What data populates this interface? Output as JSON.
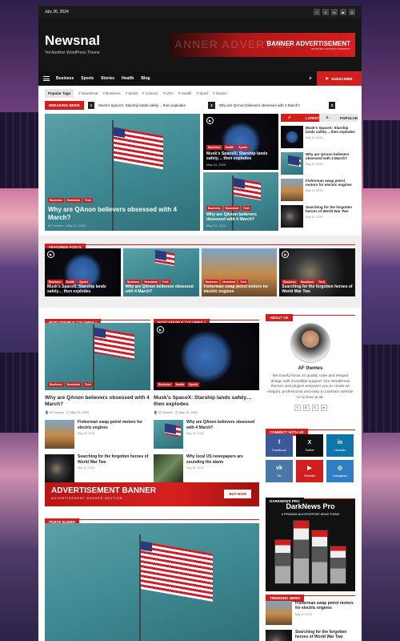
{
  "topbar": {
    "date": "July 26, 2024",
    "social": [
      "f",
      "X",
      "in",
      "▶",
      "◎"
    ]
  },
  "header": {
    "logo": "Newsnal",
    "tagline": "Yet Another WordPress Theme",
    "banner_title": "BANNER ADVERTISEMENT",
    "banner_sub": "BANNER ADVERTISEMENT",
    "banner_ghost": "ANNER ADVERTISE"
  },
  "nav": {
    "items": [
      "Business",
      "Sports",
      "Stories",
      "Health",
      "Blog"
    ],
    "subscribe": "SUBSCRIBE"
  },
  "tags": {
    "label": "Popular Tags",
    "items": [
      "# NewsDeal",
      "# Business",
      "# World",
      "# Science",
      "# USA",
      "# Health",
      "# Sport",
      "# Stories"
    ]
  },
  "breaking": {
    "label": "BREAKING NEWS",
    "items": [
      {
        "num": "1",
        "text": "Musk's SpaceX: Starship lands safely… then explodes"
      },
      {
        "num": "2",
        "text": "Why are QAnon believers obsessed with 4 March?"
      },
      {
        "num": "3",
        "text": ""
      }
    ]
  },
  "hero": {
    "cats": [
      "Business",
      "Newsbeat",
      "Tech"
    ],
    "title": "Why are QAnon believers obsessed with 4 March?",
    "author": "AF themes",
    "date": "May 10, 2024"
  },
  "mid1": {
    "cats": [
      "Business",
      "Health",
      "Sports"
    ],
    "title": "Musk's SpaceX: Starship lands safely… then explodes",
    "date": "May 10, 2024"
  },
  "mid2": {
    "cats": [
      "Business",
      "Newsbeat",
      "Tech"
    ],
    "title": "Why are QAnon believers obsessed with 4 March?",
    "date": "May 10, 2024"
  },
  "sidebar_tabs": {
    "latest": "LATEST",
    "popular": "POPULAR",
    "items": [
      {
        "title": "Musk's SpaceX: Starship lands safely… then explodes",
        "date": "May 10, 2024"
      },
      {
        "title": "Why are QAnon believers obsessed with 4 March?",
        "date": "May 10, 2024"
      },
      {
        "title": "Fisherman swap petrol motors for electric engines",
        "date": "May 10, 2024"
      },
      {
        "title": "Searching for the forgotten heroes of World War Two",
        "date": "May 10, 2024"
      }
    ]
  },
  "featured": {
    "label": "FEATURED POSTS",
    "cards": [
      {
        "cats": [
          "Business",
          "Health",
          "Sports"
        ],
        "title": "Musk's SpaceX: Starship lands safely… then explodes"
      },
      {
        "cats": [
          "Business",
          "Newsbeat",
          "Tech"
        ],
        "title": "Why are QAnon believers obsessed with 4 March?"
      },
      {
        "cats": [
          "Business",
          "Newsbeat",
          "Tech"
        ],
        "title": "Fisherman swap petrol motors for electric engines"
      },
      {
        "cats": [
          "Business",
          "Newsbeat",
          "Tech"
        ],
        "title": "Searching for the forgotten heroes of World War Two"
      }
    ]
  },
  "col1": {
    "label": "POST DOUBLE COLUMNS 1",
    "cats": [
      "Business",
      "Newsbeat",
      "Tech"
    ],
    "title": "Why are QAnon believers obsessed with 4 March?",
    "author": "AF themes",
    "date": "May 10, 2024",
    "list": [
      {
        "title": "Fisherman swap petrol motors for electric engines",
        "date": "May 10, 2024"
      },
      {
        "title": "Searching for the forgotten heroes of World War Two",
        "date": "May 10, 2024"
      }
    ]
  },
  "col2": {
    "label": "POST DOUBLE COLUMNS 2",
    "cats": [
      "Business",
      "Health",
      "Sports"
    ],
    "title": "Musk's SpaceX: Starship lands safely… then explodes",
    "author": "AF themes",
    "date": "May 10, 2024",
    "list": [
      {
        "title": "Why are QAnon believers obsessed with 4 March?",
        "date": "May 10, 2024"
      },
      {
        "title": "Why local US newspapers are sounding the alarm",
        "date": "May 10, 2024"
      }
    ]
  },
  "ad": {
    "title": "ADVERTISEMENT BANNER",
    "sub": "ADVERTISEMENT BANNER SECTION",
    "buy": "BUY NOW"
  },
  "slider": {
    "label": "POSTS SLIDER"
  },
  "about": {
    "label": "ABOUT US",
    "name": "AF themes",
    "desc": "We mainly focus on quality code and elegant design with incredible support. Our WordPress themes and plugins empower you to create an elegant, professional and easy to maintain website in no time at all."
  },
  "connect": {
    "label": "CONNECT WITH US",
    "items": [
      {
        "name": "Facebook",
        "glyph": "f",
        "color": "#3b5998"
      },
      {
        "name": "Twitter",
        "glyph": "X",
        "color": "#111111"
      },
      {
        "name": "Linkedin",
        "glyph": "in",
        "color": "#0e76a8"
      },
      {
        "name": "VK",
        "glyph": "vk",
        "color": "#4a76a8"
      },
      {
        "name": "Youtube",
        "glyph": "▶",
        "color": "#d11f1f"
      },
      {
        "name": "Instagram",
        "glyph": "◎",
        "color": "#2f7ec4"
      }
    ]
  },
  "darknews": {
    "label": "DARKNEWS PRO",
    "title": "DarkNews Pro",
    "sub": "A PREMIUM MULTIPURPOSE NEWS THEME"
  },
  "trending": {
    "label": "TRENDING NEWS",
    "items": [
      {
        "title": "Fisherman swap petrol motors for electric engines",
        "date": "May 10, 2024"
      },
      {
        "title": "Searching for the forgotten heroes of World War Two",
        "date": ""
      }
    ]
  },
  "colors": {
    "accent": "#d11f1f",
    "dark": "#151515"
  }
}
